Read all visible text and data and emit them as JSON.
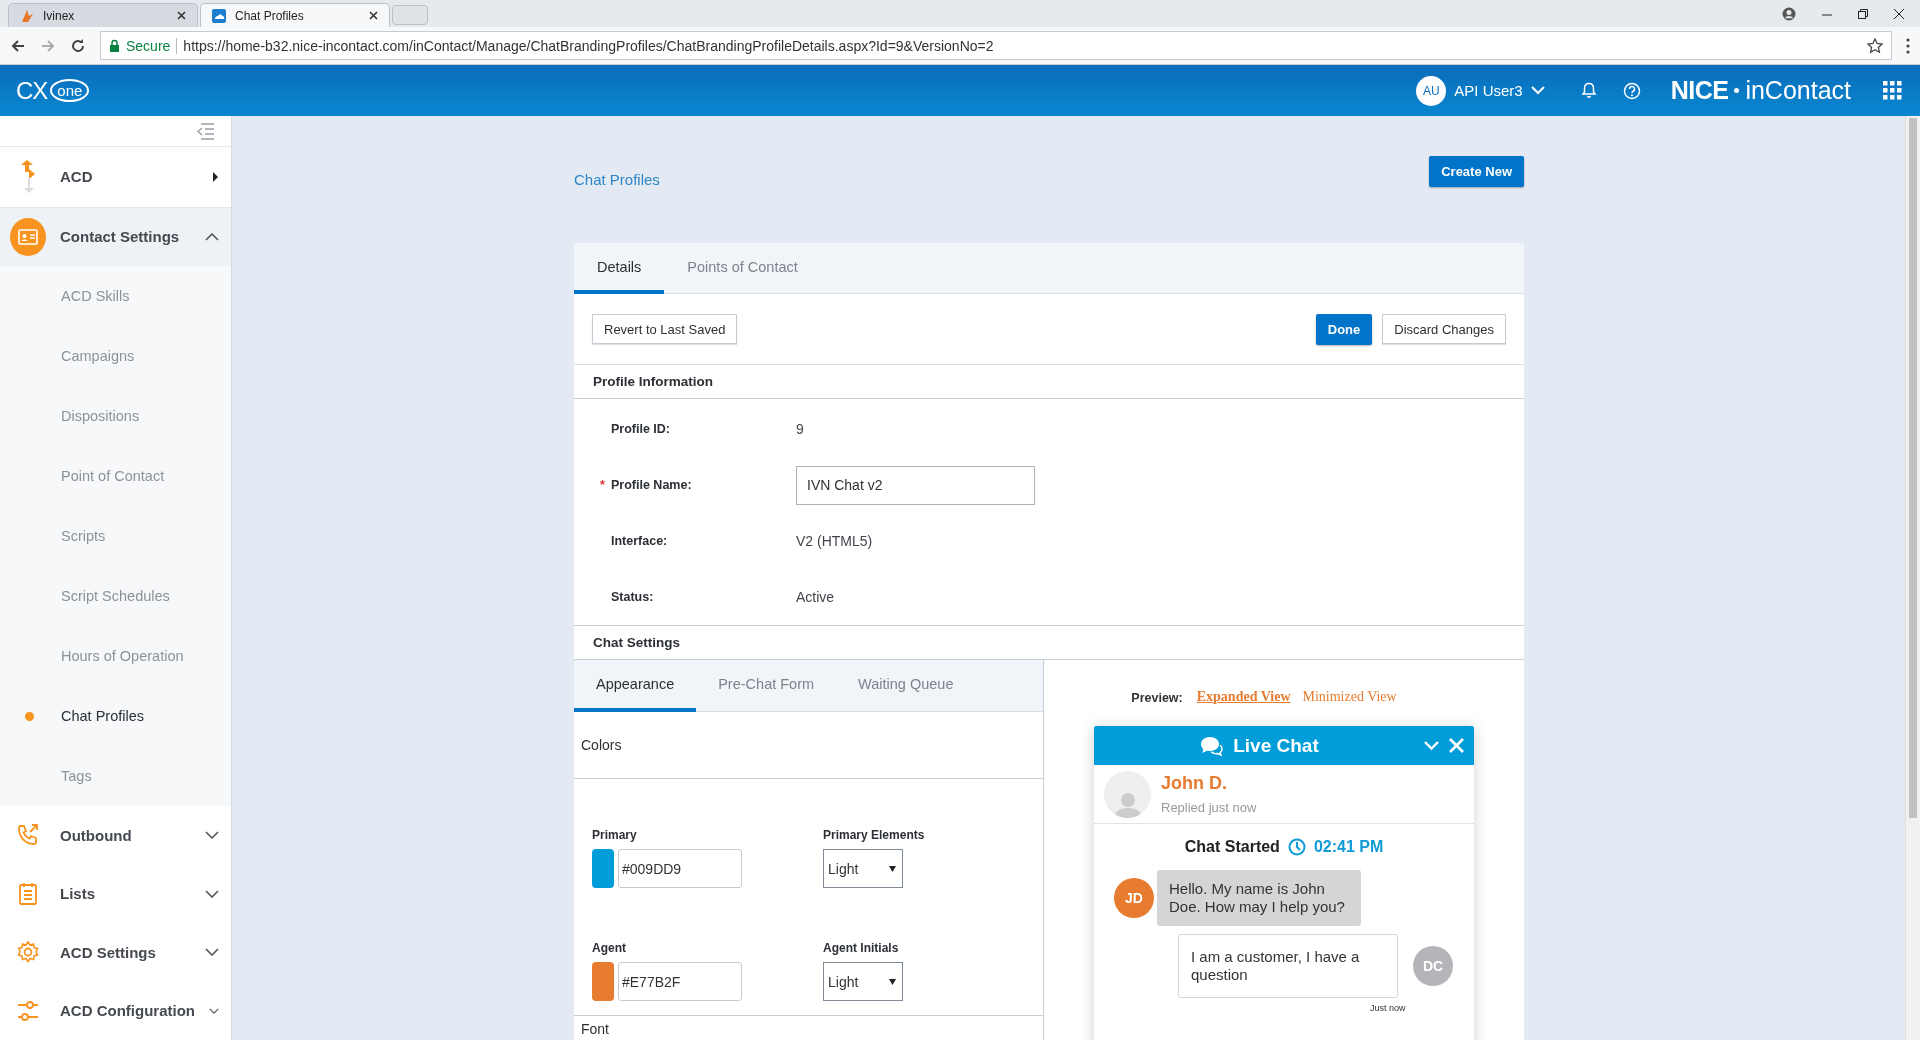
{
  "browser": {
    "tabs": [
      {
        "title": "Ivinex",
        "selected": false
      },
      {
        "title": "Chat Profiles",
        "selected": true
      }
    ],
    "secure_label": "Secure",
    "url": "https://home-b32.nice-incontact.com/inContact/Manage/ChatBrandingProfiles/ChatBrandingProfileDetails.aspx?Id=9&VersionNo=2"
  },
  "header": {
    "logo_1": "CX",
    "logo_2": "one",
    "user_initials": "AU",
    "user_name": "API User3",
    "brand_1": "NICE",
    "brand_2": "inContact"
  },
  "sidebar": {
    "items": [
      {
        "label": "ACD",
        "kind": "flyout"
      },
      {
        "label": "Contact Settings",
        "kind": "group",
        "expanded": true,
        "children": [
          {
            "label": "ACD Skills",
            "selected": false
          },
          {
            "label": "Campaigns",
            "selected": false
          },
          {
            "label": "Dispositions",
            "selected": false
          },
          {
            "label": "Point of Contact",
            "selected": false
          },
          {
            "label": "Scripts",
            "selected": false
          },
          {
            "label": "Script Schedules",
            "selected": false
          },
          {
            "label": "Hours of Operation",
            "selected": false
          },
          {
            "label": "Chat Profiles",
            "selected": true
          },
          {
            "label": "Tags",
            "selected": false
          }
        ]
      },
      {
        "label": "Outbound",
        "kind": "group",
        "expanded": false
      },
      {
        "label": "Lists",
        "kind": "group",
        "expanded": false
      },
      {
        "label": "ACD Settings",
        "kind": "group",
        "expanded": false
      },
      {
        "label": "ACD Configuration",
        "kind": "group",
        "expanded": false
      }
    ]
  },
  "main": {
    "breadcrumb": "Chat Profiles",
    "create_button": "Create New",
    "tabs": [
      {
        "label": "Details",
        "selected": true
      },
      {
        "label": "Points of Contact",
        "selected": false
      }
    ],
    "revert_button": "Revert to Last Saved",
    "done_button": "Done",
    "discard_button": "Discard Changes",
    "profile_section": {
      "title": "Profile Information",
      "required_mark": "*",
      "fields": [
        {
          "label": "Profile ID:",
          "value": "9",
          "kind": "text",
          "required": false
        },
        {
          "label": "Profile Name:",
          "value": "IVN Chat v2",
          "kind": "input",
          "required": true
        },
        {
          "label": "Interface:",
          "value": "V2 (HTML5)",
          "kind": "text",
          "required": false
        },
        {
          "label": "Status:",
          "value": "Active",
          "kind": "text",
          "required": false
        }
      ]
    },
    "chat_settings": {
      "title": "Chat Settings",
      "tabs": [
        {
          "label": "Appearance",
          "selected": true
        },
        {
          "label": "Pre-Chat Form",
          "selected": false
        },
        {
          "label": "Waiting Queue",
          "selected": false
        }
      ],
      "colors_title": "Colors",
      "color_rows": [
        {
          "label": "Primary",
          "value": "#009DD9",
          "color": "#009dd9",
          "select_label": "Primary Elements",
          "select_value": "Light"
        },
        {
          "label": "Agent",
          "value": "#E77B2F",
          "color": "#e77b2f",
          "select_label": "Agent Initials",
          "select_value": "Light"
        }
      ],
      "next_section": "Font"
    },
    "preview": {
      "label": "Preview:",
      "views": [
        {
          "label": "Expanded View",
          "selected": true
        },
        {
          "label": "Minimized View",
          "selected": false
        }
      ],
      "widget": {
        "title": "Live Chat",
        "agent_name": "John D.",
        "agent_status": "Replied just now",
        "started_label": "Chat Started",
        "started_time": "02:41 PM",
        "messages": [
          {
            "kind": "agent",
            "initials": "JD",
            "text": "Hello. My name is John Doe. How may I help you?"
          },
          {
            "kind": "customer",
            "initials": "DC",
            "text": "I am a customer, I have a question",
            "time": "Just now"
          }
        ]
      }
    }
  }
}
